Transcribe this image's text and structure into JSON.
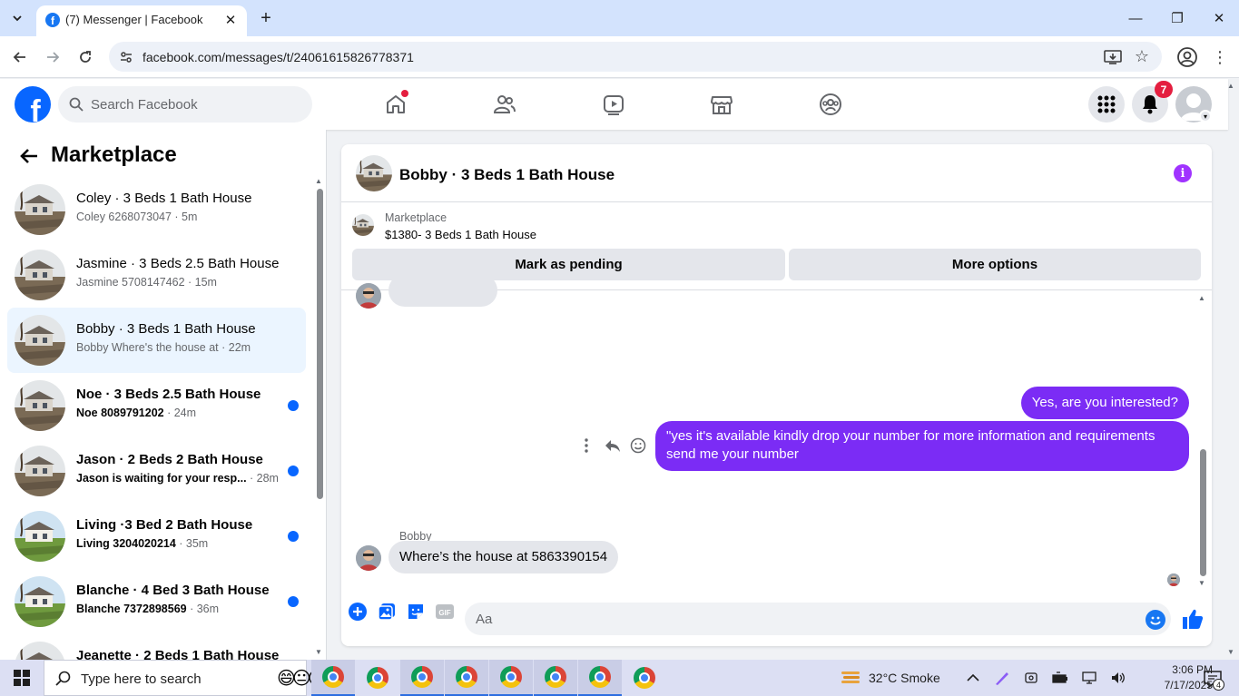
{
  "browser": {
    "tab_title": "(7) Messenger | Facebook",
    "url": "facebook.com/messages/t/24061615826778371"
  },
  "fb_header": {
    "search_placeholder": "Search Facebook",
    "notification_count": "7"
  },
  "left_panel": {
    "title": "Marketplace",
    "conversations": [
      {
        "title": "Coley · 3 Beds 1 Bath House",
        "subtitle": "Coley 6268073047",
        "time": " · 5m",
        "unread": false,
        "selected": false
      },
      {
        "title": "Jasmine · 3 Beds 2.5 Bath House",
        "subtitle": "Jasmine 5708147462",
        "time": " · 15m",
        "unread": false,
        "selected": false
      },
      {
        "title": "Bobby · 3 Beds 1 Bath House",
        "subtitle": "Bobby Where's the house at",
        "time": " · 22m",
        "unread": false,
        "selected": true
      },
      {
        "title": "Noe · 3 Beds 2.5 Bath House",
        "subtitle": "Noe 8089791202",
        "time": " · 24m",
        "unread": true,
        "selected": false
      },
      {
        "title": "Jason · 2 Beds 2 Bath House",
        "subtitle": "Jason is waiting for your resp...",
        "time": " · 28m",
        "unread": true,
        "selected": false
      },
      {
        "title": "Living ·3 Bed 2 Bath House",
        "subtitle": "Living 3204020214",
        "time": " · 35m",
        "unread": true,
        "selected": false
      },
      {
        "title": "Blanche · 4 Bed 3 Bath House",
        "subtitle": "Blanche 7372898569",
        "time": " · 36m",
        "unread": true,
        "selected": false
      },
      {
        "title": "Jeanette · 2 Beds 1 Bath House",
        "subtitle": "",
        "time": "",
        "unread": true,
        "selected": false
      }
    ]
  },
  "chat": {
    "title": "Bobby · 3 Beds 1 Bath House",
    "marketplace_label": "Marketplace",
    "listing": "$1380- 3 Beds 1 Bath House",
    "mark_pending": "Mark as pending",
    "more_options": "More options",
    "messages": {
      "out_1": "Yes, are you interested?",
      "out_2": "\"yes it's available kindly drop your number for more information and requirements send me your number",
      "sender": "Bobby",
      "in_1": "Where’s the house at 5863390154"
    },
    "input_placeholder": "Aa"
  },
  "taskbar": {
    "search_text": "Type here to search",
    "weather": "32°C  Smoke",
    "time": "3:06 PM",
    "date": "7/17/2025",
    "notif_count": "4"
  },
  "colors": {
    "fb_blue": "#0866ff",
    "message_purple": "#7b2cf5",
    "selected_bg": "#ebf5ff"
  }
}
